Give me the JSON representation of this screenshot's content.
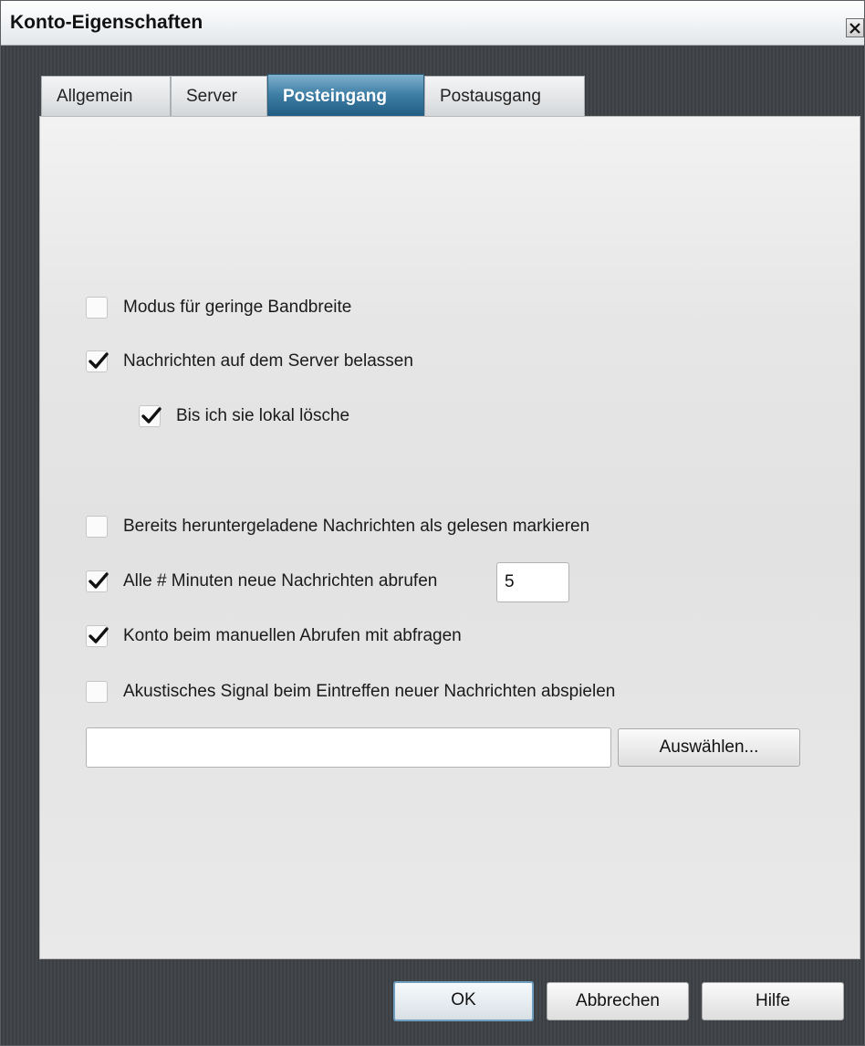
{
  "window": {
    "title": "Konto-Eigenschaften"
  },
  "tabs": [
    {
      "label": "Allgemein",
      "active": false
    },
    {
      "label": "Server",
      "active": false
    },
    {
      "label": "Posteingang",
      "active": true
    },
    {
      "label": "Postausgang",
      "active": false
    }
  ],
  "options": {
    "low_bandwidth": {
      "label": "Modus für geringe Bandbreite",
      "checked": false
    },
    "leave_on_server": {
      "label": "Nachrichten auf dem Server belassen",
      "checked": true
    },
    "until_deleted": {
      "label": "Bis ich sie lokal lösche",
      "checked": true
    },
    "mark_read": {
      "label": "Bereits heruntergeladene Nachrichten als gelesen markieren",
      "checked": false
    },
    "check_every": {
      "label": "Alle # Minuten neue Nachrichten abrufen",
      "checked": true,
      "value": "5"
    },
    "manual_check": {
      "label": "Konto beim manuellen Abrufen mit abfragen",
      "checked": true
    },
    "sound": {
      "label": "Akustisches Signal beim Eintreffen neuer Nachrichten abspielen",
      "checked": false,
      "path": ""
    }
  },
  "buttons": {
    "browse": "Auswählen...",
    "ok": "OK",
    "cancel": "Abbrechen",
    "help": "Hilfe"
  },
  "colors": {
    "active_tab": "#2f6f96",
    "ok_border": "#6f9fc0"
  },
  "icons": {
    "close": "close-icon",
    "check": "checkmark-icon"
  }
}
